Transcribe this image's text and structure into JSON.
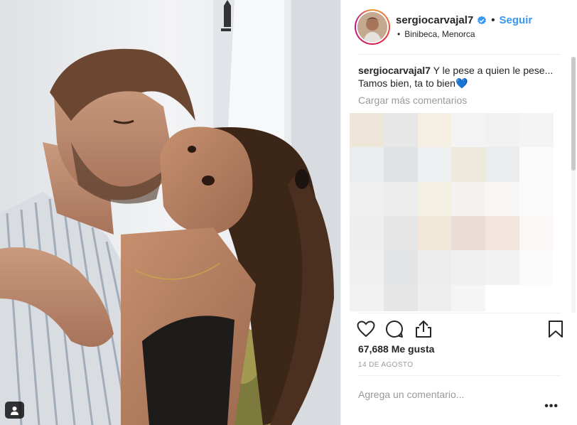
{
  "post": {
    "username": "sergiocarvajal7",
    "follow_label": "Seguir",
    "separator": "•",
    "location_bullet": "•",
    "location": "Binibeca, Menorca",
    "caption_user": "sergiocarvajal7",
    "caption_text": "Y le pese a quien le pese... Tamos bien, ta to bien",
    "caption_emoji": "💙",
    "load_more": "Cargar más comentarios",
    "likes": "67,688 Me gusta",
    "date": "14 DE AGOSTO",
    "comment_placeholder": "Agrega un comentario...",
    "more_options": "•••"
  },
  "colors": {
    "accent": "#3897f0",
    "text": "#262626",
    "muted": "#999999"
  },
  "icons": {
    "like": "heart-icon",
    "comment": "comment-icon",
    "share": "share-icon",
    "save": "bookmark-icon",
    "verified": "verified-badge-icon",
    "tag": "user-tag-icon"
  }
}
